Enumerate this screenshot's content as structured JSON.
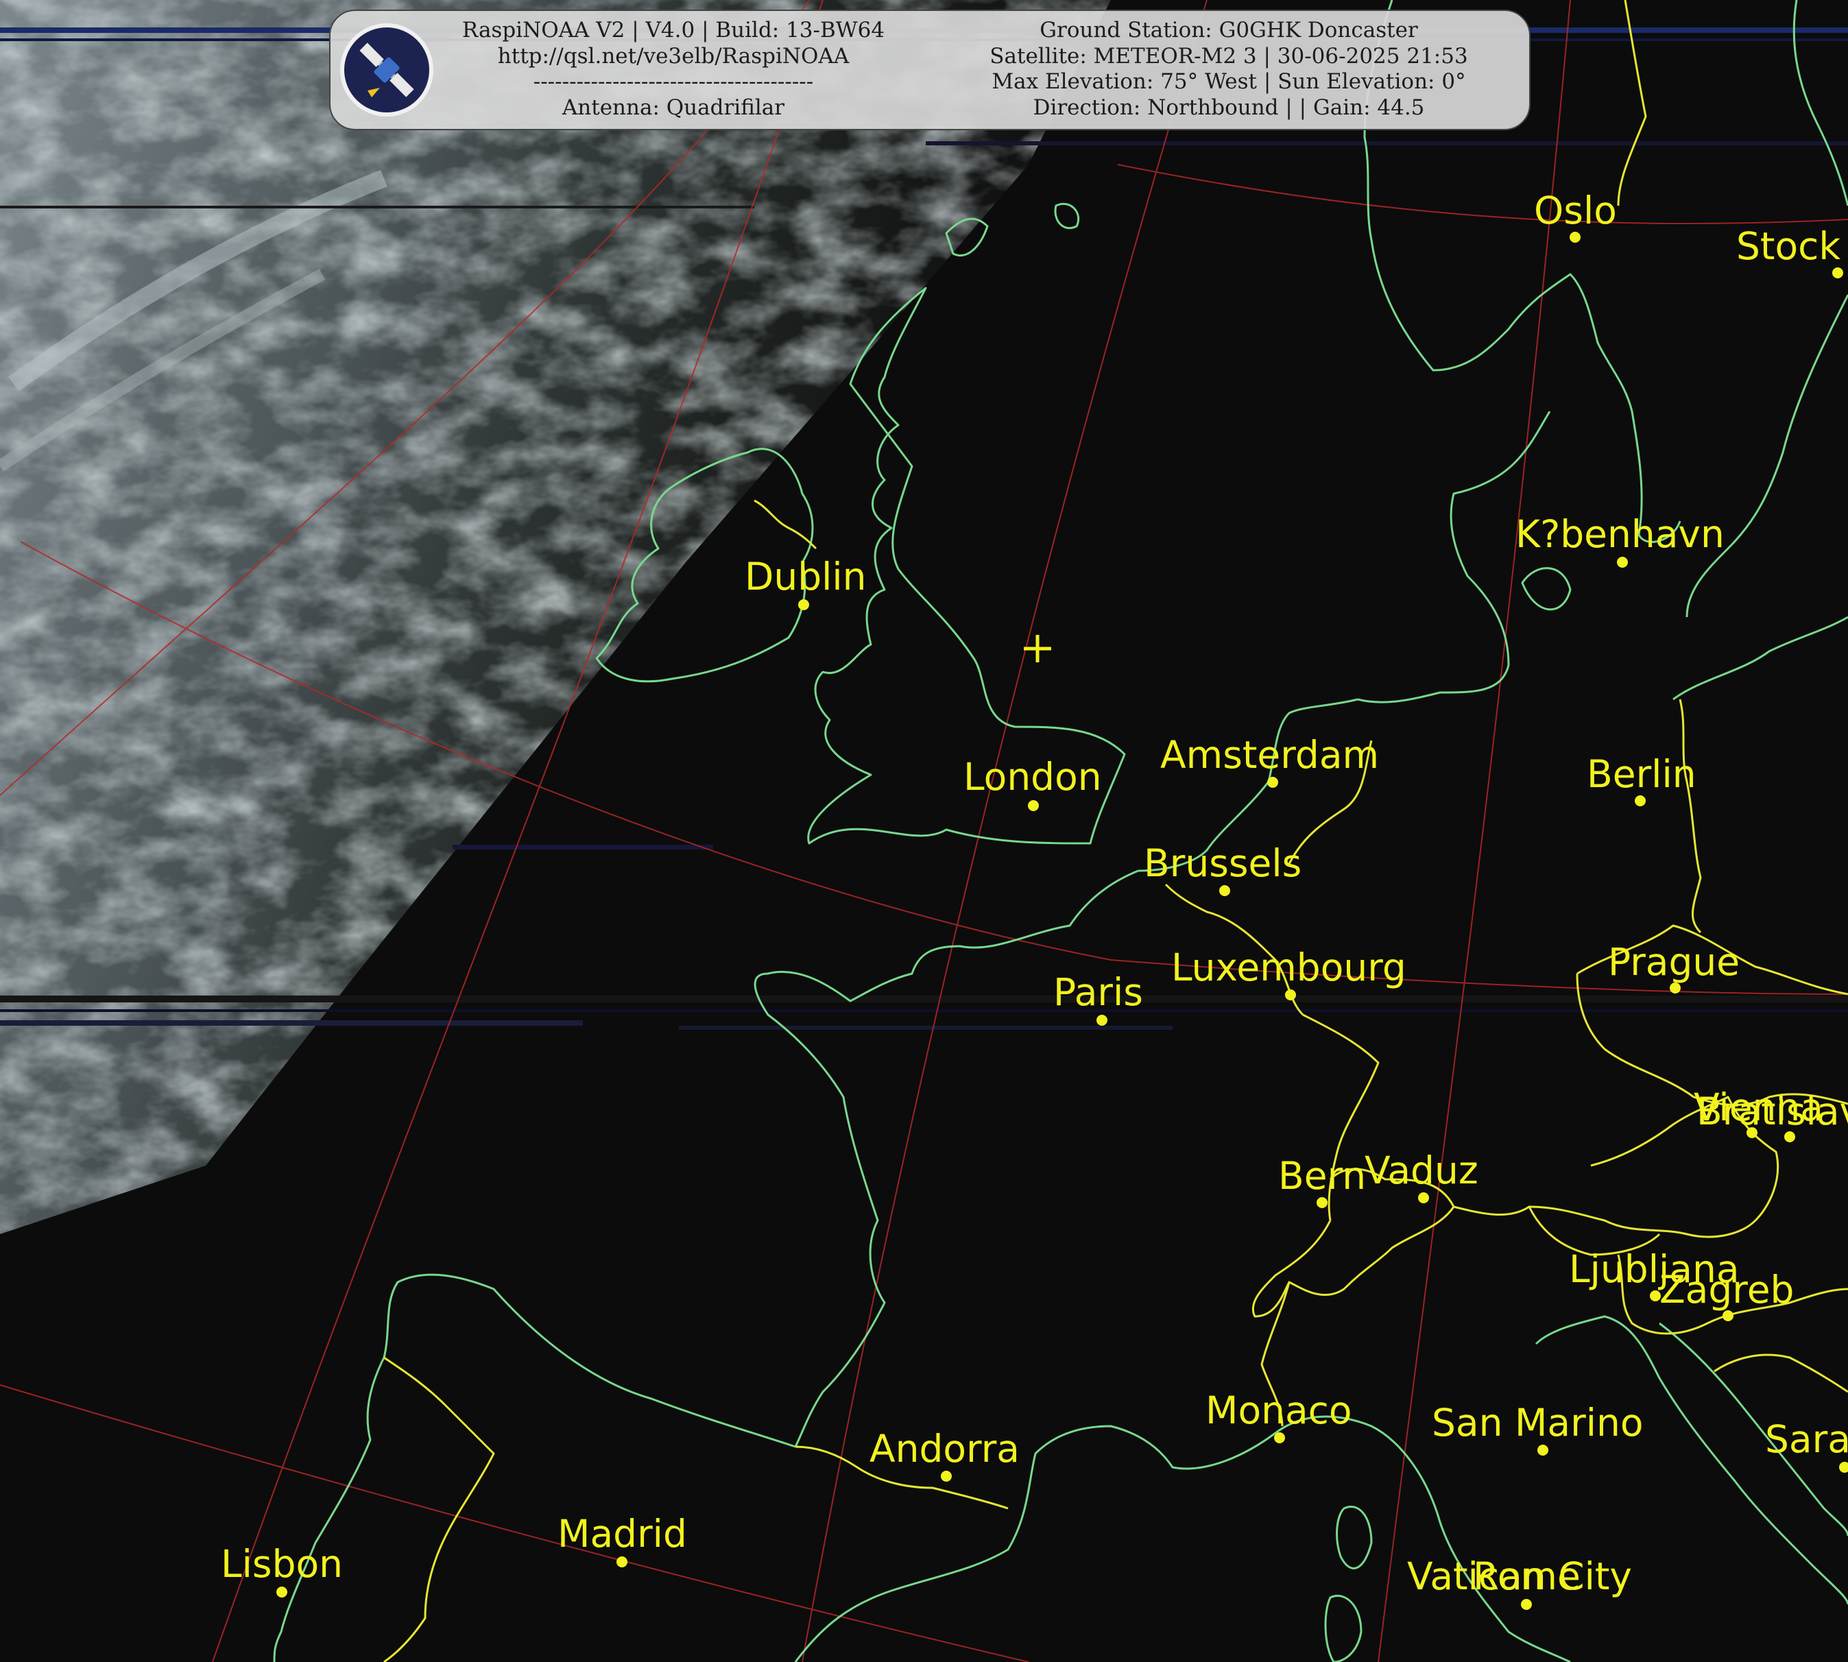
{
  "banner": {
    "left_lines": [
      "RaspiNOAA V2 | V4.0 | Build: 13-BW64",
      "http://qsl.net/ve3elb/RaspiNOAA",
      "---------------------------------------",
      "Antenna: Quadrifilar"
    ],
    "right_lines": [
      "Ground Station: G0GHK Doncaster",
      "Satellite: METEOR-M2 3 | 30-06-2025 21:53",
      "Max Elevation: 75° West | Sun Elevation: 0°",
      "Direction: Northbound | | Gain: 44.5"
    ],
    "logo_icon": "satellite-icon"
  },
  "colors": {
    "background": "#0c0c0c",
    "coastline": "#78d88c",
    "border": "#e6e632",
    "graticule": "#b42828",
    "city": "#f2f21e",
    "cloud": "#aab4b8"
  },
  "ground_station_marker": "plus-icon",
  "cities": [
    {
      "name": "Oslo"
    },
    {
      "name": "Stock"
    },
    {
      "name": "K?benhavn"
    },
    {
      "name": "Dublin"
    },
    {
      "name": "London"
    },
    {
      "name": "Amsterdam"
    },
    {
      "name": "Berlin"
    },
    {
      "name": "Brussels"
    },
    {
      "name": "Luxembourg"
    },
    {
      "name": "Paris"
    },
    {
      "name": "Prague"
    },
    {
      "name": "Vienna"
    },
    {
      "name": "Bratislav"
    },
    {
      "name": "Bern"
    },
    {
      "name": "Vaduz"
    },
    {
      "name": "Ljubljana"
    },
    {
      "name": "Zagreb"
    },
    {
      "name": "Monaco"
    },
    {
      "name": "San Marino"
    },
    {
      "name": "Sara"
    },
    {
      "name": "Andorra"
    },
    {
      "name": "Madrid"
    },
    {
      "name": "Lisbon"
    },
    {
      "name": "Vatican City"
    },
    {
      "name": "Rome"
    }
  ]
}
